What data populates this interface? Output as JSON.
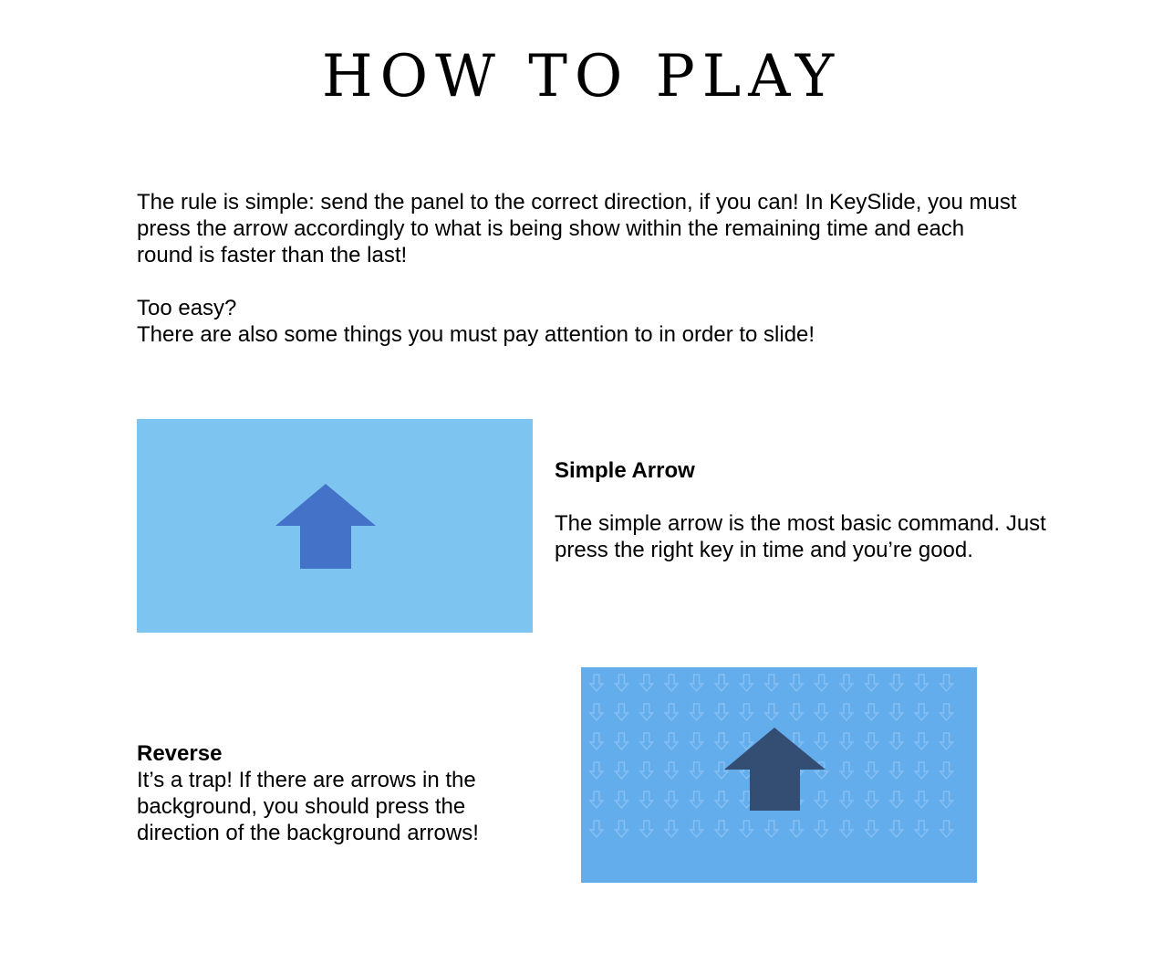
{
  "title": "HOW TO PLAY",
  "intro": {
    "paragraph1": "The rule is simple: send the panel to the correct direction, if you can! In KeySlide, you must press the arrow accordingly to what is being show within the remaining time and each round is faster than the last!",
    "line1": "Too easy?",
    "line2": "There are also some things you must pay attention to in order to slide!"
  },
  "simple_arrow": {
    "heading": "Simple Arrow",
    "description": "The simple arrow is the most basic command. Just press the right key in time and you’re good.",
    "panel_color": "#7dc4f0",
    "arrow_color": "#4472c8",
    "arrow_direction": "up"
  },
  "reverse": {
    "heading": "Reverse",
    "description": "It’s a trap! If there are arrows in the background, you should press the direction of the background arrows!",
    "panel_color": "#64adec",
    "arrow_color": "#334d73",
    "arrow_direction": "up",
    "background_arrow_direction": "down",
    "background_arrow_color": "#86c0f2"
  }
}
